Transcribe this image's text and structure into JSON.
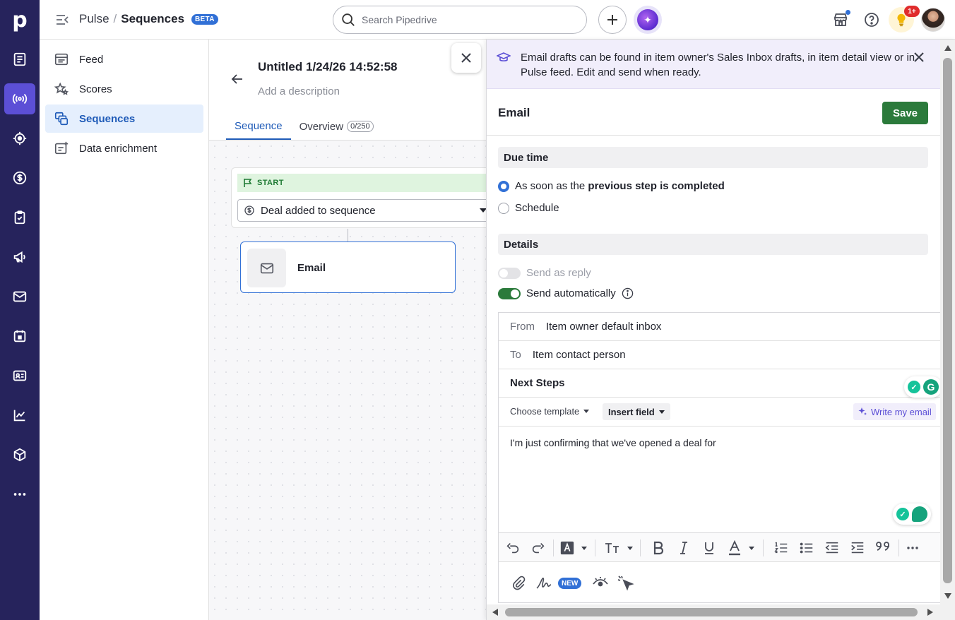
{
  "app": {
    "logo": "p"
  },
  "rail": {
    "items": [
      {
        "icon": "leads-inbox-icon"
      },
      {
        "icon": "pulse-broadcast-icon",
        "active": true
      },
      {
        "icon": "target-icon"
      },
      {
        "icon": "deals-dollar-icon"
      },
      {
        "icon": "activities-clipboard-icon"
      },
      {
        "icon": "campaigns-megaphone-icon"
      },
      {
        "icon": "mail-icon"
      },
      {
        "icon": "calendar-icon"
      },
      {
        "icon": "contacts-card-icon"
      },
      {
        "icon": "insights-chart-icon"
      },
      {
        "icon": "products-box-icon"
      },
      {
        "icon": "more-icon"
      }
    ]
  },
  "header": {
    "breadcrumb_parent": "Pulse",
    "breadcrumb_sep": "/",
    "breadcrumb_current": "Sequences",
    "badge": "BETA",
    "search_placeholder": "Search Pipedrive",
    "notifications_count": "1+"
  },
  "subnav": {
    "items": [
      {
        "label": "Feed",
        "icon": "feed-icon"
      },
      {
        "label": "Scores",
        "icon": "scores-stars-icon"
      },
      {
        "label": "Sequences",
        "icon": "sequences-icon",
        "active": true
      },
      {
        "label": "Data enrichment",
        "icon": "data-enrichment-icon"
      }
    ]
  },
  "sequence": {
    "title": "Untitled 1/24/26 14:52:58",
    "description_placeholder": "Add a description",
    "tabs": [
      {
        "label": "Sequence",
        "active": true
      },
      {
        "label": "Overview",
        "count": "0/250"
      }
    ],
    "start_label": "START",
    "trigger": "Deal added to sequence",
    "step_label": "Email"
  },
  "panel": {
    "banner": "Email drafts can be found in item owner's Sales Inbox drafts, in item detail view or in Pulse feed. Edit and send when ready.",
    "title": "Email",
    "save_label": "Save",
    "due_time_heading": "Due time",
    "due_option_1_prefix": "As soon as the ",
    "due_option_1_bold": "previous step is completed",
    "due_option_2": "Schedule",
    "details_heading": "Details",
    "send_as_reply": "Send as reply",
    "send_automatically": "Send automatically",
    "from_label": "From",
    "from_value": "Item owner default inbox",
    "to_label": "To",
    "to_value": "Item contact person",
    "subject": "Next Steps",
    "choose_template": "Choose template",
    "insert_field": "Insert field",
    "write_my_email": "Write my email",
    "body": "I'm just confirming that we've opened a deal for",
    "new_badge": "NEW"
  },
  "colors": {
    "rail_bg": "#26235c",
    "accent_blue": "#3170d6",
    "save_green": "#2b7a3b",
    "ai_purple": "#5c4fd6"
  }
}
